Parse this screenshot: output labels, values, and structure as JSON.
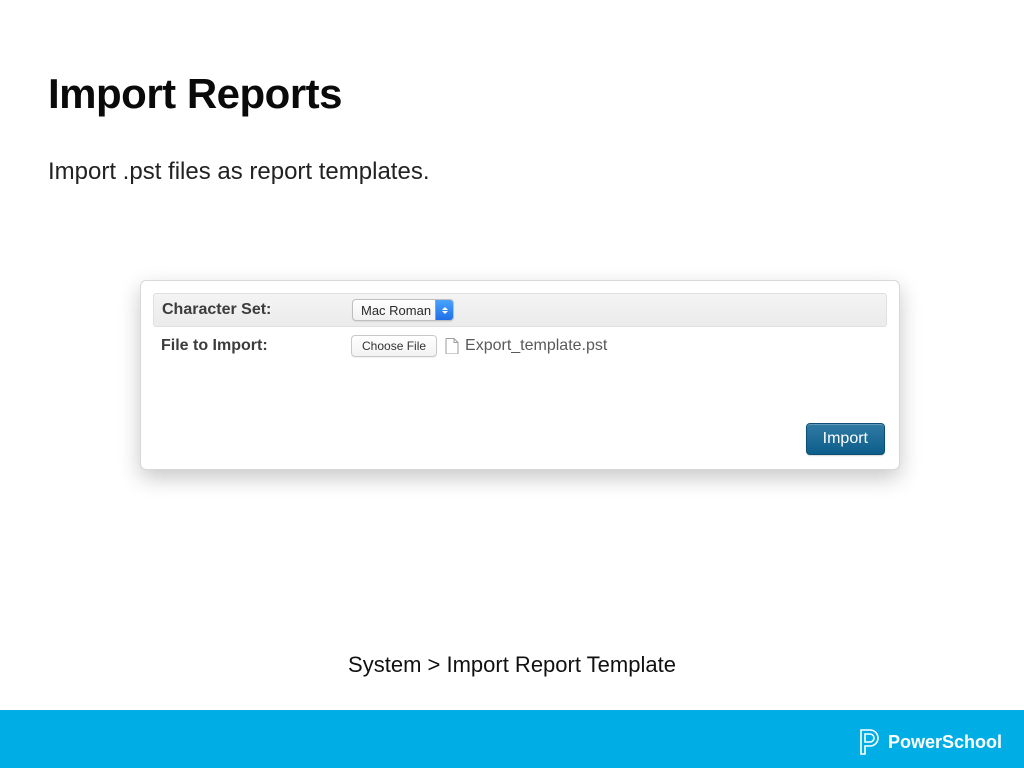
{
  "title": "Import Reports",
  "subtitle": "Import .pst files as report templates.",
  "form": {
    "charset_label": "Character Set:",
    "charset_value": "Mac Roman",
    "file_label": "File to Import:",
    "choose_file_label": "Choose File",
    "selected_filename": "Export_template.pst",
    "import_button_label": "Import"
  },
  "breadcrumb": "System > Import Report Template",
  "brand": {
    "name": "PowerSchool"
  },
  "colors": {
    "footer_bg": "#00aee5",
    "import_btn_bg": "#14658f"
  }
}
